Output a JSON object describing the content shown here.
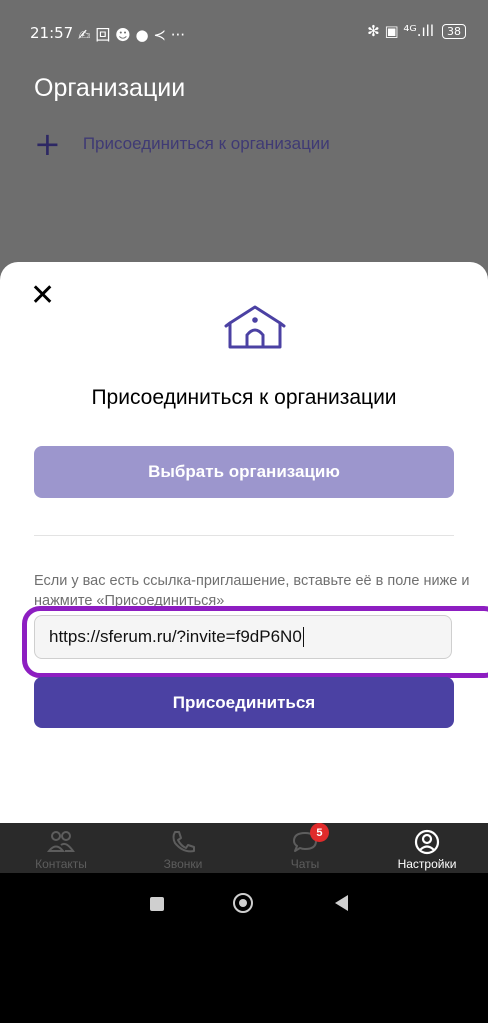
{
  "status_bar": {
    "time": "21:57",
    "left_icons": "✍ 回 ☻ ● ≺ ···",
    "right_icons": "✻ ▣ ⁴ᴳ.ıll",
    "battery": "38"
  },
  "background": {
    "title": "Организации",
    "join_link": "Присоединиться к организации"
  },
  "sheet": {
    "title": "Присоединиться к организации",
    "choose_button": "Выбрать организацию",
    "hint": "Если у вас есть ссылка-приглашение, вставьте её в поле ниже и нажмите «Присоединиться»",
    "invite_value": "https://sferum.ru/?invite=f9dP6N0",
    "join_button": "Присоединиться"
  },
  "tabs": [
    {
      "label": "Контакты",
      "icon": "contacts-icon"
    },
    {
      "label": "Звонки",
      "icon": "phone-icon"
    },
    {
      "label": "Чаты",
      "icon": "chat-icon",
      "badge": "5"
    },
    {
      "label": "Настройки",
      "icon": "profile-icon",
      "active": true
    }
  ],
  "colors": {
    "accent": "#4b41a3",
    "accent_light": "#9c96cd",
    "highlight": "#8d1ec1",
    "badge": "#e02b2b"
  }
}
